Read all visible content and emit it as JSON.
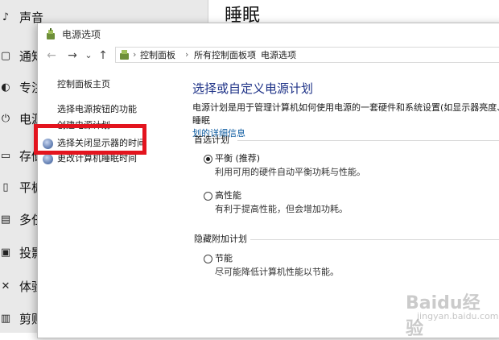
{
  "background_settings": {
    "sidebar_items": [
      {
        "icon": "speaker-icon",
        "glyph": "♪",
        "label": "声音"
      },
      {
        "icon": "notification-icon",
        "glyph": "▢",
        "label": "通知"
      },
      {
        "icon": "focus-assist-icon",
        "glyph": "◐",
        "label": "专注"
      },
      {
        "icon": "power-icon",
        "glyph": "⏻",
        "label": "电源"
      },
      {
        "icon": "storage-icon",
        "glyph": "▭",
        "label": "存储"
      },
      {
        "icon": "tablet-icon",
        "glyph": "▯",
        "label": "平板"
      },
      {
        "icon": "multitasking-icon",
        "glyph": "▤",
        "label": "多任"
      },
      {
        "icon": "projecting-icon",
        "glyph": "▣",
        "label": "投影"
      },
      {
        "icon": "shared-experience-icon",
        "glyph": "✕",
        "label": "体验"
      },
      {
        "icon": "clipboard-icon",
        "glyph": "▥",
        "label": "剪贴"
      }
    ],
    "right_title": "睡眠"
  },
  "window": {
    "title": "电源选项",
    "nav": {
      "back": "←",
      "forward": "→",
      "dropdown": "⌄",
      "up": "↑"
    },
    "breadcrumb": [
      {
        "label": "控制面板"
      },
      {
        "label": "所有控制面板项"
      },
      {
        "label": "电源选项"
      }
    ],
    "left_pane": {
      "home": "控制面板主页",
      "power_buttons": "选择电源按钮的功能",
      "create_plan": "创建电源计划",
      "display_off": "选择关闭显示器的时间",
      "sleep_time": "更改计算机睡眠时间"
    },
    "main": {
      "title": "选择或自定义电源计划",
      "desc_text": "电源计划是用于管理计算机如何使用电源的一套硬件和系统设置(如显示器亮度、睡眠",
      "desc_link": "划的详细信息",
      "preferred_header": "首选计划",
      "plans": [
        {
          "name": "平衡 (推荐)",
          "desc": "利用可用的硬件自动平衡功耗与性能。",
          "selected": true
        },
        {
          "name": "高性能",
          "desc": "有利于提高性能，但会增加功耗。",
          "selected": false
        }
      ],
      "hidden_header": "隐藏附加计划",
      "hidden_plans": [
        {
          "name": "节能",
          "desc": "尽可能降低计算机性能以节能。",
          "selected": false
        }
      ]
    }
  },
  "watermark": {
    "text": "Baidu经验",
    "sub": "jingyan.baidu.com"
  },
  "colors": {
    "highlight": "#e3141e",
    "title_blue": "#1e3287",
    "link_blue": "#0b5aa0"
  }
}
